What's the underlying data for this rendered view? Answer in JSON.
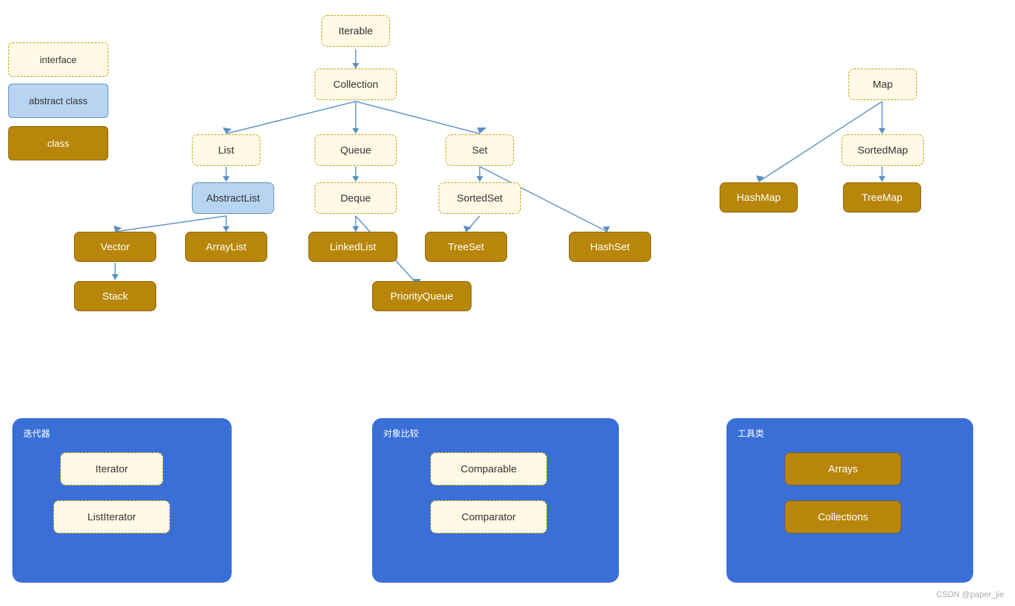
{
  "legend": {
    "interface_label": "interface",
    "abstract_label": "abstract class",
    "class_label": "class"
  },
  "nodes": {
    "iterable": "Iterable",
    "collection": "Collection",
    "list": "List",
    "queue": "Queue",
    "set": "Set",
    "abstract_list": "AbstractList",
    "deque": "Deque",
    "sorted_set": "SortedSet",
    "vector": "Vector",
    "array_list": "ArrayList",
    "linked_list": "LinkedList",
    "tree_set": "TreeSet",
    "hash_set": "HashSet",
    "stack": "Stack",
    "priority_queue": "PriorityQueue",
    "map": "Map",
    "sorted_map": "SortedMap",
    "hash_map": "HashMap",
    "tree_map": "TreeMap"
  },
  "panels": {
    "iterator_title": "迭代器",
    "iterator": "Iterator",
    "list_iterator": "ListIterator",
    "compare_title": "对象比较",
    "comparable": "Comparable",
    "comparator": "Comparator",
    "tools_title": "工具类",
    "arrays": "Arrays",
    "collections": "Collections"
  },
  "watermark": "CSDN @paper_jie"
}
